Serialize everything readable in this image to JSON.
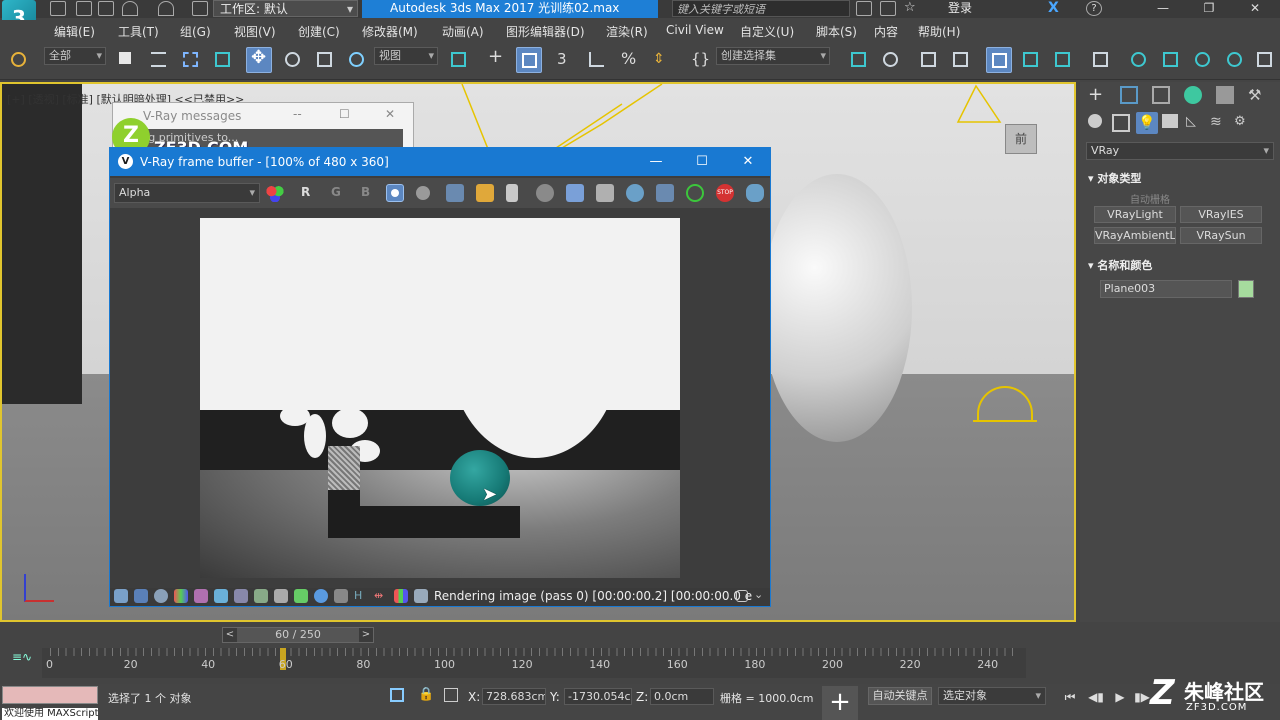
{
  "titlebar": {
    "app_logo": "3",
    "workspace_label": "工作区: 默认",
    "app_title": "Autodesk 3ds Max 2017     光训练02.max",
    "search_placeholder": "键入关键字或短语",
    "login_label": "登录"
  },
  "menu": [
    "编辑(E)",
    "工具(T)",
    "组(G)",
    "视图(V)",
    "创建(C)",
    "修改器(M)",
    "动画(A)",
    "图形编辑器(D)",
    "渲染(R)",
    "Civil View",
    "自定义(U)",
    "脚本(S)",
    "内容",
    "帮助(H)"
  ],
  "toolbar": {
    "filter_select": "全部",
    "ref_coord_select": "视图",
    "named_selection_select": "创建选择集"
  },
  "viewport": {
    "label": "[+] [透视] [标准] [默认明暗处理] <<已禁用>>",
    "viewcube_label": "前"
  },
  "vray_messages": {
    "title": "V-Ray messages",
    "subtitle": "oving primitives to..."
  },
  "zf3d_logo": {
    "letter": "Z",
    "text": "ZF3D.COM"
  },
  "vfb": {
    "title": "V-Ray frame buffer - [100% of 480 x 360]",
    "channel": "Alpha",
    "ch_r": "R",
    "ch_g": "G",
    "ch_b": "B",
    "status": "Rendering image (pass 0) [00:00:00.2] [00:00:00.0 e"
  },
  "command_panel": {
    "category": "VRay",
    "section_object_type": "对象类型",
    "auto_grid": "自动栅格",
    "buttons": [
      "VRayLight",
      "VRayIES",
      "VRayAmbientLight",
      "VRaySun"
    ],
    "section_name_color": "名称和颜色",
    "object_name": "Plane003",
    "object_color": "#a6dc9e"
  },
  "timeline": {
    "slider_label": "60 / 250",
    "ticks": [
      "0",
      "20",
      "40",
      "60",
      "80",
      "100",
      "120",
      "140",
      "160",
      "180",
      "200",
      "220",
      "240"
    ],
    "current_frame": 60,
    "total_frames": 250
  },
  "statusbar": {
    "maxscript_text": "欢迎使用 MAXScript",
    "status_msg": "选择了 1 个 对象",
    "x_label": "X:",
    "x_value": "728.683cm",
    "y_label": "Y:",
    "y_value": "-1730.054c",
    "z_label": "Z:",
    "z_value": "0.0cm",
    "grid_info": "栅格 = 1000.0cm",
    "autokey_label": "自动关键点",
    "selected_set": "选定对象"
  },
  "watermark": {
    "letter": "Z",
    "text": "朱峰社区",
    "sub": "ZF3D.COM"
  },
  "colors": {
    "accent": "#1979d2",
    "viewport_border": "#e0c52e",
    "active_tool": "#5c87c1"
  }
}
